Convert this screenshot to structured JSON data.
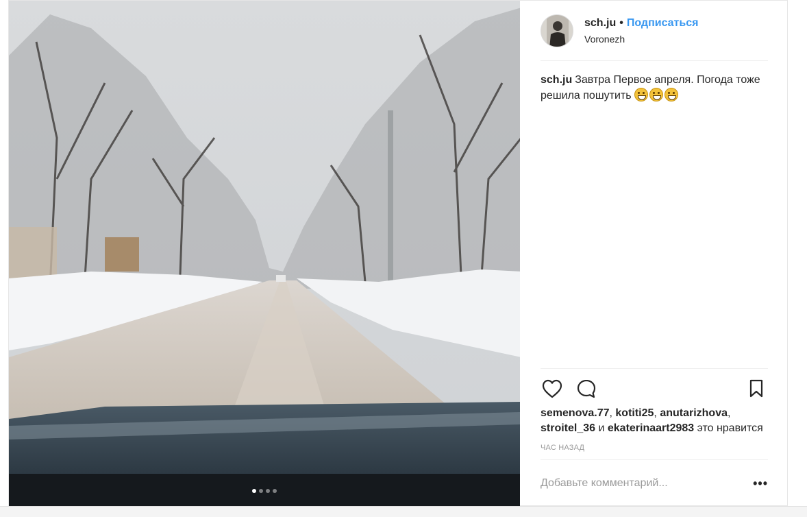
{
  "post": {
    "username": "sch.ju",
    "separator": "•",
    "follow_label": "Подписаться",
    "location": "Voronezh",
    "caption_user": "sch.ju",
    "caption_text": "Завтра Первое апреля. Погода тоже решила пошутить",
    "caption_emoji": [
      "grinning-face-emoji",
      "grinning-face-emoji",
      "grinning-face-emoji"
    ],
    "likes": {
      "users": [
        "semenova.77",
        "kotiti25",
        "anutarizhova",
        "stroitel_36",
        "ekaterinaart2983"
      ],
      "separator_1": ", ",
      "separator_2": ", ",
      "separator_3": ",",
      "conjunction": " и ",
      "suffix": " это нравится"
    },
    "timestamp": "час назад",
    "comment_placeholder": "Добавьте комментарий...",
    "more_label": "•••",
    "carousel": {
      "count": 4,
      "active": 1
    }
  },
  "icons": {
    "like": "heart-icon",
    "comment": "comment-bubble-icon",
    "save": "bookmark-icon",
    "avatar": "user-avatar"
  },
  "colors": {
    "link_blue": "#3897f0",
    "text": "#262626",
    "muted": "#999999",
    "border": "#efefef"
  }
}
